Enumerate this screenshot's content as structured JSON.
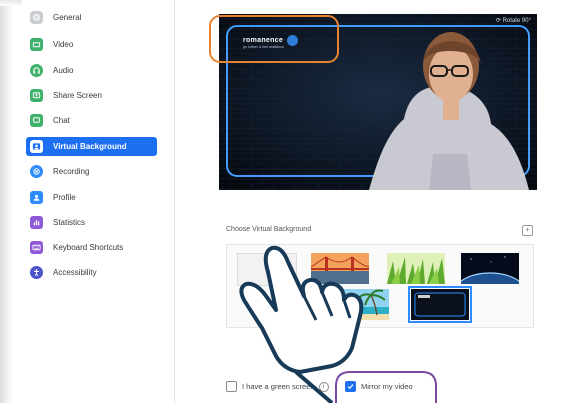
{
  "sidebar": {
    "items": [
      {
        "label": "General",
        "icon": "gear-icon",
        "color": "#c8cbd0"
      },
      {
        "label": "Video",
        "icon": "video-camera-icon",
        "color": "#3fb16d"
      },
      {
        "label": "Audio",
        "icon": "headphones-icon",
        "color": "#3fb16d"
      },
      {
        "label": "Share Screen",
        "icon": "share-screen-icon",
        "color": "#3fb16d"
      },
      {
        "label": "Chat",
        "icon": "chat-bubble-icon",
        "color": "#3fb16d"
      },
      {
        "label": "Virtual Background",
        "icon": "virtual-background-icon",
        "color": "#1d6ff2"
      },
      {
        "label": "Recording",
        "icon": "record-icon",
        "color": "#2f8cff"
      },
      {
        "label": "Profile",
        "icon": "profile-icon",
        "color": "#2f8cff"
      },
      {
        "label": "Statistics",
        "icon": "statistics-icon",
        "color": "#8e5ad8"
      },
      {
        "label": "Keyboard Shortcuts",
        "icon": "keyboard-icon",
        "color": "#8e5ad8"
      },
      {
        "label": "Accessibility",
        "icon": "accessibility-icon",
        "color": "#4c54c9"
      }
    ],
    "active_index": 5,
    "accent": "#1d6ff2"
  },
  "preview": {
    "rotate_label": "Rotate 90°",
    "logo_text": "romanence",
    "logo_sub": "go further & feel ambitious"
  },
  "backgrounds": {
    "section_label": "Choose Virtual Background",
    "add_symbol": "+",
    "thumbnails": [
      "none",
      "golden-gate-bridge",
      "green-grass",
      "earth-from-space",
      "beach-palm",
      "custom-neon-frame"
    ],
    "selected": "custom-neon-frame"
  },
  "options": {
    "green_screen_label": "I have a green screen",
    "green_screen_checked": false,
    "mirror_label": "Mirror my video",
    "mirror_checked": true
  },
  "annotations": {
    "orange": "#e8822e",
    "purple": "#7b4aa0",
    "hand": "#163a57"
  }
}
